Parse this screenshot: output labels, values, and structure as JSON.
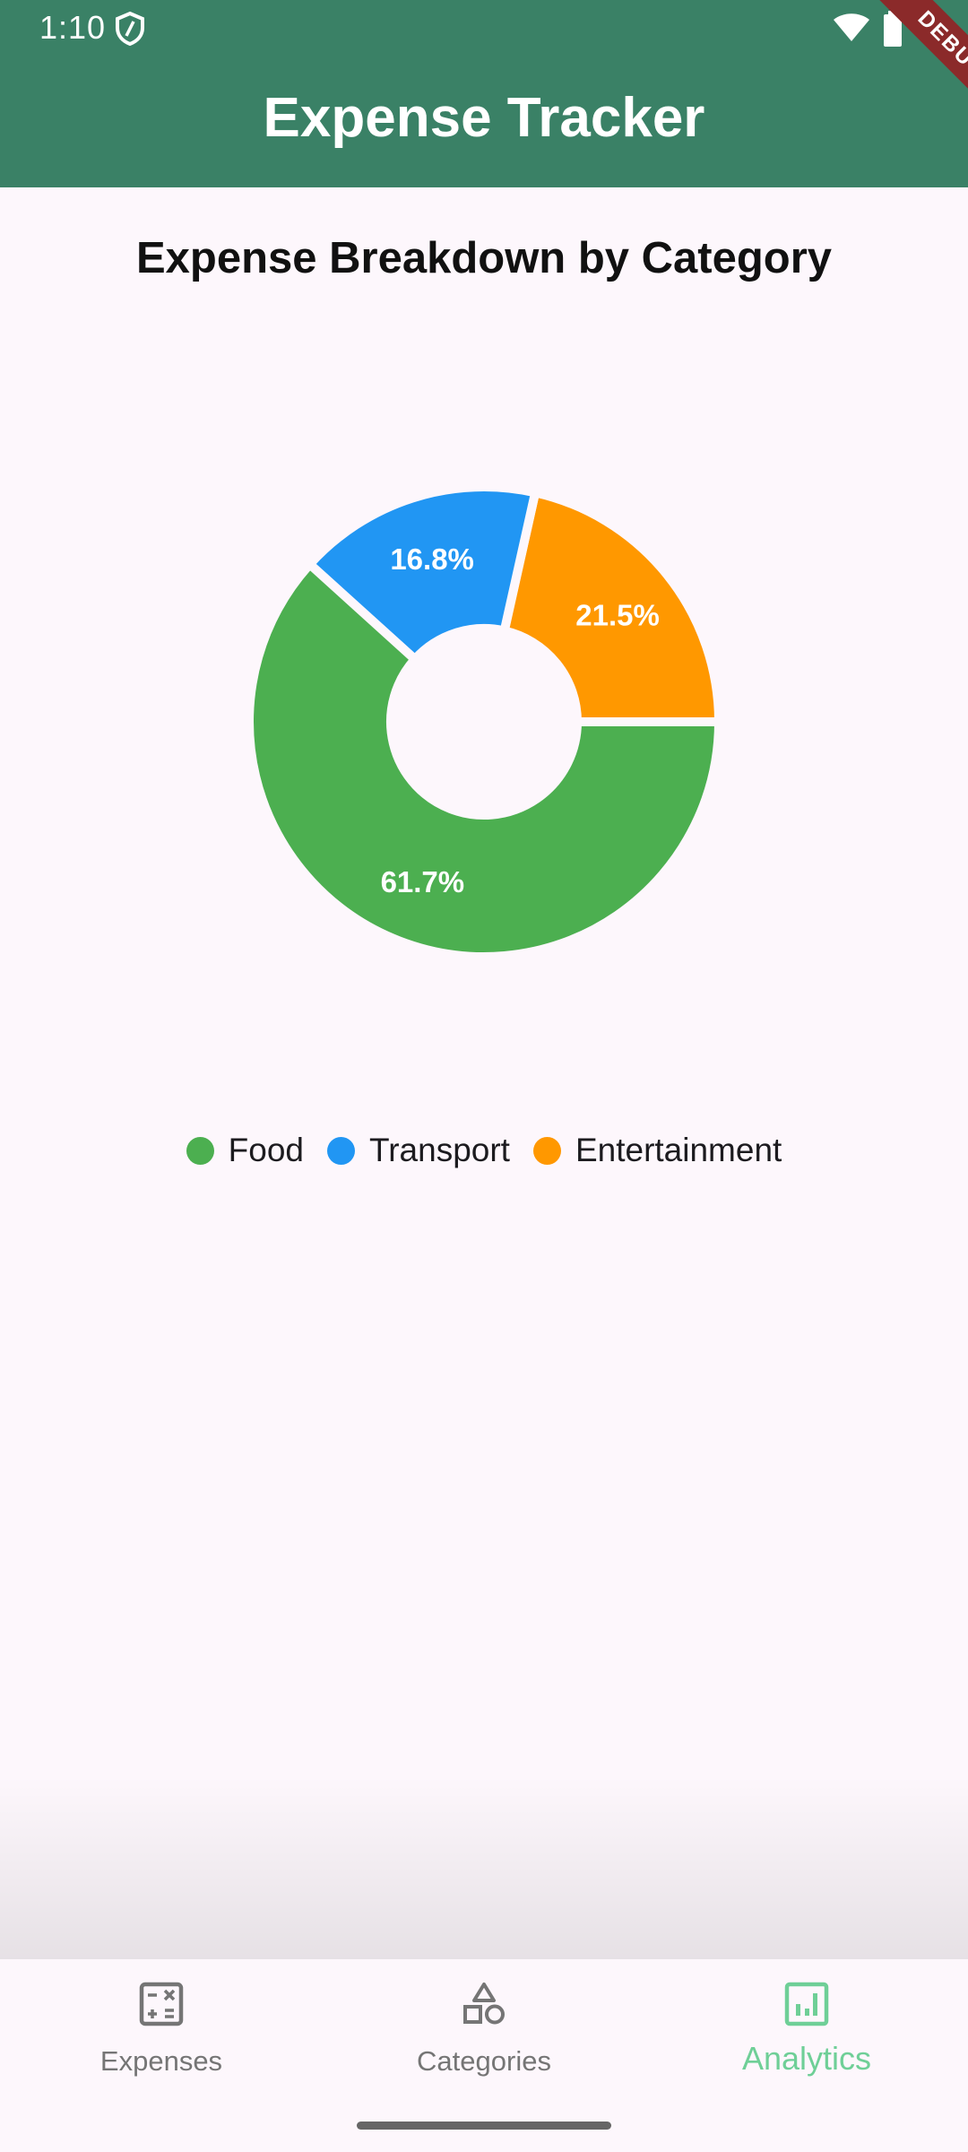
{
  "status_bar": {
    "time": "1:10",
    "icons": [
      "shield-icon",
      "wifi-icon",
      "battery-icon"
    ]
  },
  "app_bar": {
    "title": "Expense Tracker",
    "color": "#3a8166",
    "debug_label": "DEBUG"
  },
  "chart_data": {
    "type": "pie",
    "donut": true,
    "title": "Expense Breakdown by Category",
    "categories": [
      "Food",
      "Transport",
      "Entertainment"
    ],
    "values": [
      61.7,
      16.8,
      21.5
    ],
    "labels": [
      "61.7%",
      "16.8%",
      "21.5%"
    ],
    "colors": [
      "#4caf50",
      "#2196f3",
      "#ff9800"
    ],
    "legend": "bottom"
  },
  "bottom_nav": {
    "items": [
      {
        "label": "Expenses",
        "icon": "calculator-icon",
        "active": false
      },
      {
        "label": "Categories",
        "icon": "shapes-icon",
        "active": false
      },
      {
        "label": "Analytics",
        "icon": "analytics-icon",
        "active": true
      }
    ],
    "active_color": "#6fcf97",
    "inactive_color": "#757575"
  }
}
